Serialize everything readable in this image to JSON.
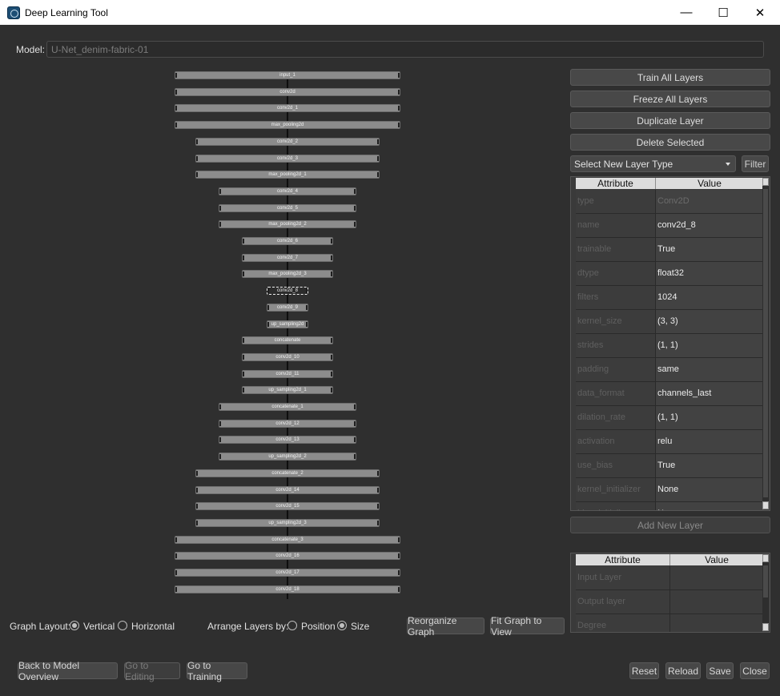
{
  "window": {
    "title": "Deep Learning Tool",
    "minimize": "—",
    "maximize": "☐",
    "close": "✕"
  },
  "model": {
    "label": "Model:",
    "value": "U-Net_denim-fabric-01"
  },
  "graph": {
    "nodes": [
      "input_1",
      "conv2d",
      "conv2d_1",
      "max_pooling2d",
      "conv2d_2",
      "conv2d_3",
      "max_pooling2d_1",
      "conv2d_4",
      "conv2d_5",
      "max_pooling2d_2",
      "conv2d_6",
      "conv2d_7",
      "max_pooling2d_3",
      "conv2d_8",
      "conv2d_9",
      "up_sampling2d",
      "concatenate",
      "conv2d_10",
      "conv2d_11",
      "up_sampling2d_1",
      "concatenate_1",
      "conv2d_12",
      "conv2d_13",
      "up_sampling2d_2",
      "concatenate_2",
      "conv2d_14",
      "conv2d_15",
      "up_sampling2d_3",
      "concatenate_3",
      "conv2d_16",
      "conv2d_17",
      "conv2d_18"
    ],
    "selected": "conv2d_8"
  },
  "actions": {
    "train_all": "Train All Layers",
    "freeze_all": "Freeze All Layers",
    "duplicate": "Duplicate Layer",
    "delete": "Delete Selected",
    "layer_type_select": "Select New Layer Type",
    "filter": "Filter",
    "add_layer": "Add New Layer"
  },
  "attributes": {
    "headers": [
      "Attribute",
      "Value"
    ],
    "rows": [
      [
        "type",
        "Conv2D"
      ],
      [
        "name",
        "conv2d_8"
      ],
      [
        "trainable",
        "True"
      ],
      [
        "dtype",
        "float32"
      ],
      [
        "filters",
        "1024"
      ],
      [
        "kernel_size",
        "(3, 3)"
      ],
      [
        "strides",
        "(1, 1)"
      ],
      [
        "padding",
        "same"
      ],
      [
        "data_format",
        "channels_last"
      ],
      [
        "dilation_rate",
        "(1, 1)"
      ],
      [
        "activation",
        "relu"
      ],
      [
        "use_bias",
        "True"
      ],
      [
        "kernel_initializer",
        "None"
      ],
      [
        "bias_initializer",
        "None"
      ]
    ]
  },
  "connections": {
    "headers": [
      "Attribute",
      "Value"
    ],
    "rows": [
      [
        "Input Layer",
        ""
      ],
      [
        "Output layer",
        ""
      ],
      [
        "Degree",
        ""
      ]
    ]
  },
  "layout": {
    "graph_layout_label": "Graph Layout:",
    "vertical": "Vertical",
    "horizontal": "Horizontal",
    "graph_layout_value": "Vertical",
    "arrange_label": "Arrange Layers by:",
    "position": "Position",
    "size": "Size",
    "arrange_value": "Size",
    "reorganize": "Reorganize Graph",
    "fit": "Fit Graph to View"
  },
  "footer": {
    "back": "Back to Model Overview",
    "editing": "Go to Editing",
    "training": "Go to Training",
    "reset": "Reset",
    "reload": "Reload",
    "save": "Save",
    "close": "Close"
  }
}
